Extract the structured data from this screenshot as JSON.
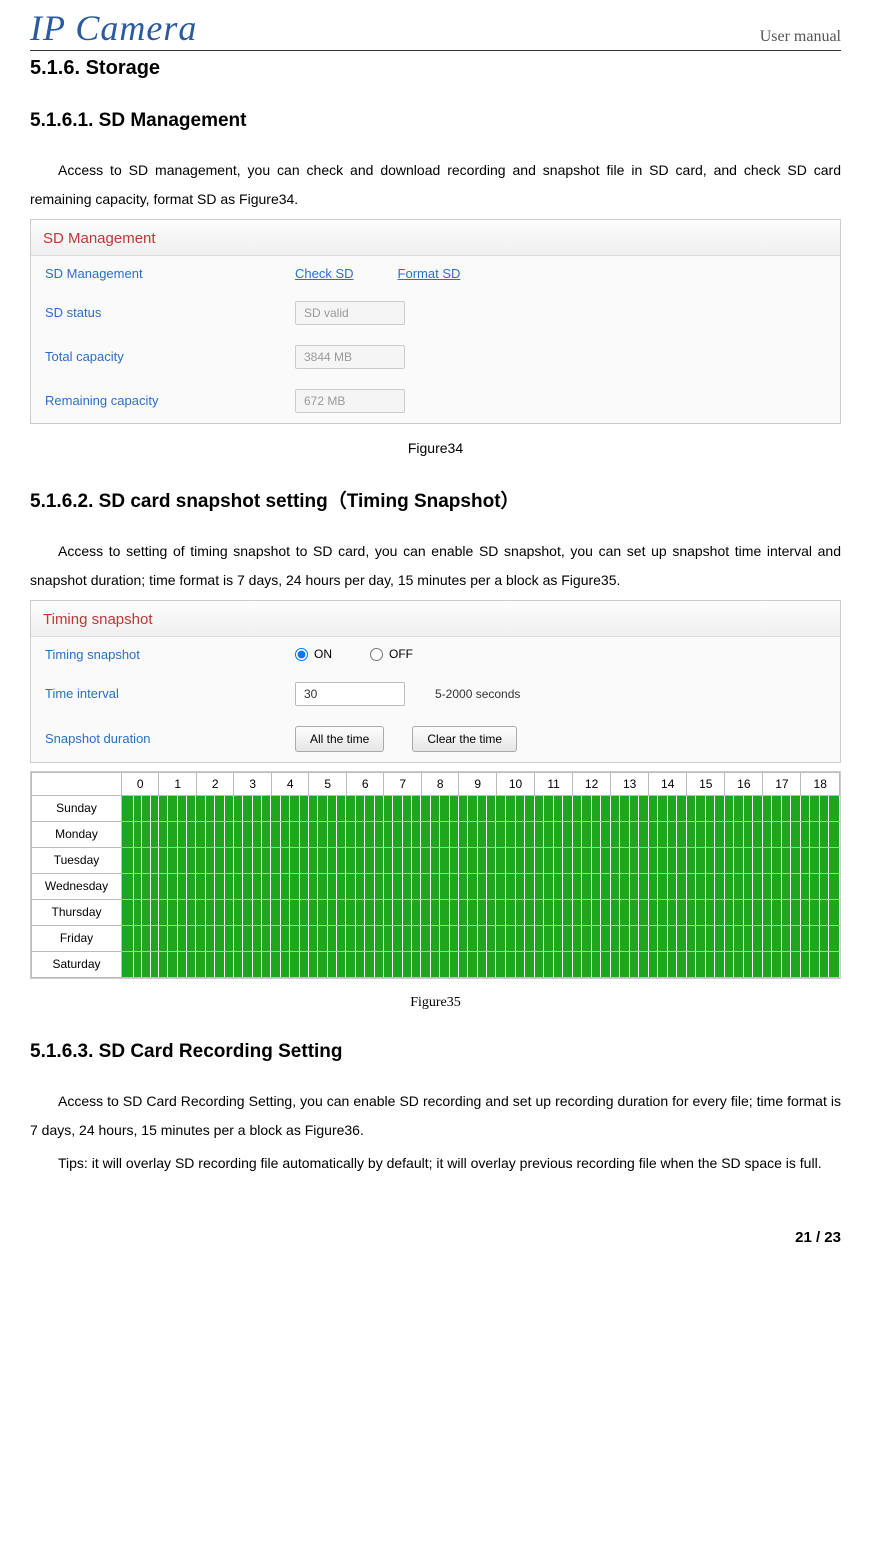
{
  "header": {
    "logo": "IP Camera",
    "manual": "User manual"
  },
  "s1": {
    "title": "5.1.6.  Storage",
    "h2a": "5.1.6.1. SD Management",
    "p1": "Access to SD management, you can check and download recording and snapshot file in SD card, and check SD card remaining capacity, format SD as Figure34.",
    "panelTitle": "SD Management",
    "rows": {
      "mgmtLabel": "SD Management",
      "checkSD": "Check SD",
      "formatSD": "Format SD",
      "statusLabel": "SD status",
      "statusVal": "SD valid",
      "totalLabel": "Total capacity",
      "totalVal": "3844 MB",
      "remainLabel": "Remaining capacity",
      "remainVal": "672 MB"
    },
    "cap": "Figure34"
  },
  "s2": {
    "h2": "5.1.6.2. SD card snapshot setting（Timing Snapshot）",
    "p1": "Access to setting of timing snapshot to SD card, you can enable SD snapshot, you can set up snapshot time interval and snapshot duration; time format is 7 days, 24 hours per day, 15 minutes per a block as Figure35.",
    "panelTitle": "Timing snapshot",
    "rows": {
      "tsLabel": "Timing snapshot",
      "on": "ON",
      "off": "OFF",
      "onChecked": true,
      "tiLabel": "Time interval",
      "tiVal": "30",
      "tiHint": "5-2000 seconds",
      "sdLabel": "Snapshot duration",
      "btnAll": "All the time",
      "btnClear": "Clear the time"
    },
    "sched": {
      "hours": [
        "0",
        "1",
        "2",
        "3",
        "4",
        "5",
        "6",
        "7",
        "8",
        "9",
        "10",
        "11",
        "12",
        "13",
        "14",
        "15",
        "16",
        "17",
        "18"
      ],
      "days": [
        "Sunday",
        "Monday",
        "Tuesday",
        "Wednesday",
        "Thursday",
        "Friday",
        "Saturday"
      ]
    },
    "cap": "Figure35"
  },
  "s3": {
    "h2": "5.1.6.3. SD Card Recording Setting",
    "p1": "Access to SD Card Recording Setting, you can enable SD recording and set up recording duration for every file; time format is 7 days, 24 hours, 15 minutes per a block as Figure36.",
    "p2": "Tips: it will overlay SD recording file automatically by default; it will overlay previous recording file when the SD space is full."
  },
  "pagefoot": "21 / 23"
}
